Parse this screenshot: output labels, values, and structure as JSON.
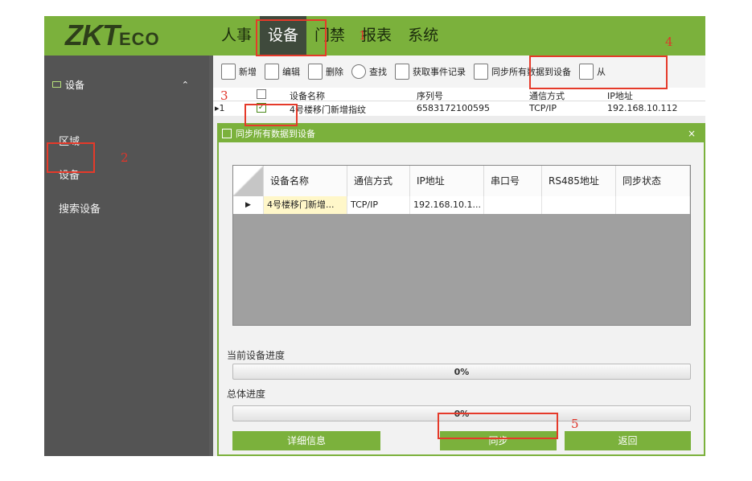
{
  "logo": {
    "main": "ZKT",
    "suffix": "ECO"
  },
  "nav": [
    {
      "label": "人事"
    },
    {
      "label": "设备"
    },
    {
      "label": "门禁"
    },
    {
      "label": "报表"
    },
    {
      "label": "系统"
    }
  ],
  "sidebar": {
    "section": "设备",
    "items": [
      {
        "label": "区域"
      },
      {
        "label": "设备"
      },
      {
        "label": "搜索设备"
      }
    ]
  },
  "toolbar": [
    {
      "label": "新增",
      "icon": "add-icon"
    },
    {
      "label": "编辑",
      "icon": "edit-icon"
    },
    {
      "label": "删除",
      "icon": "trash-icon"
    },
    {
      "label": "查找",
      "icon": "search-icon"
    },
    {
      "label": "获取事件记录",
      "icon": "event-icon"
    },
    {
      "label": "同步所有数据到设备",
      "icon": "sync-icon"
    },
    {
      "label": "从",
      "icon": "fetch-icon"
    }
  ],
  "device_grid": {
    "columns": [
      "设备名称",
      "序列号",
      "通信方式",
      "IP地址"
    ],
    "row": {
      "index": "1",
      "name": "4号楼移门新增指纹",
      "serial": "6583172100595",
      "comm": "TCP/IP",
      "ip": "192.168.10.112"
    }
  },
  "dialog": {
    "title": "同步所有数据到设备",
    "close": "×",
    "columns": [
      "设备名称",
      "通信方式",
      "IP地址",
      "串口号",
      "RS485地址",
      "同步状态"
    ],
    "row": {
      "name": "4号楼移门新增...",
      "comm": "TCP/IP",
      "ip": "192.168.10.1...",
      "serial_port": "",
      "rs485": "",
      "status": ""
    },
    "current_label": "当前设备进度",
    "current_pct": "0%",
    "total_label": "总体进度",
    "total_pct": "0%",
    "btn_detail": "详细信息",
    "btn_sync": "同步",
    "btn_back": "返回"
  },
  "annotations": {
    "n1": "1",
    "n2": "2",
    "n3": "3",
    "n4": "4",
    "n5": "5"
  },
  "colors": {
    "brand_green": "#7bb13c",
    "annotation_red": "#e53a2a"
  }
}
